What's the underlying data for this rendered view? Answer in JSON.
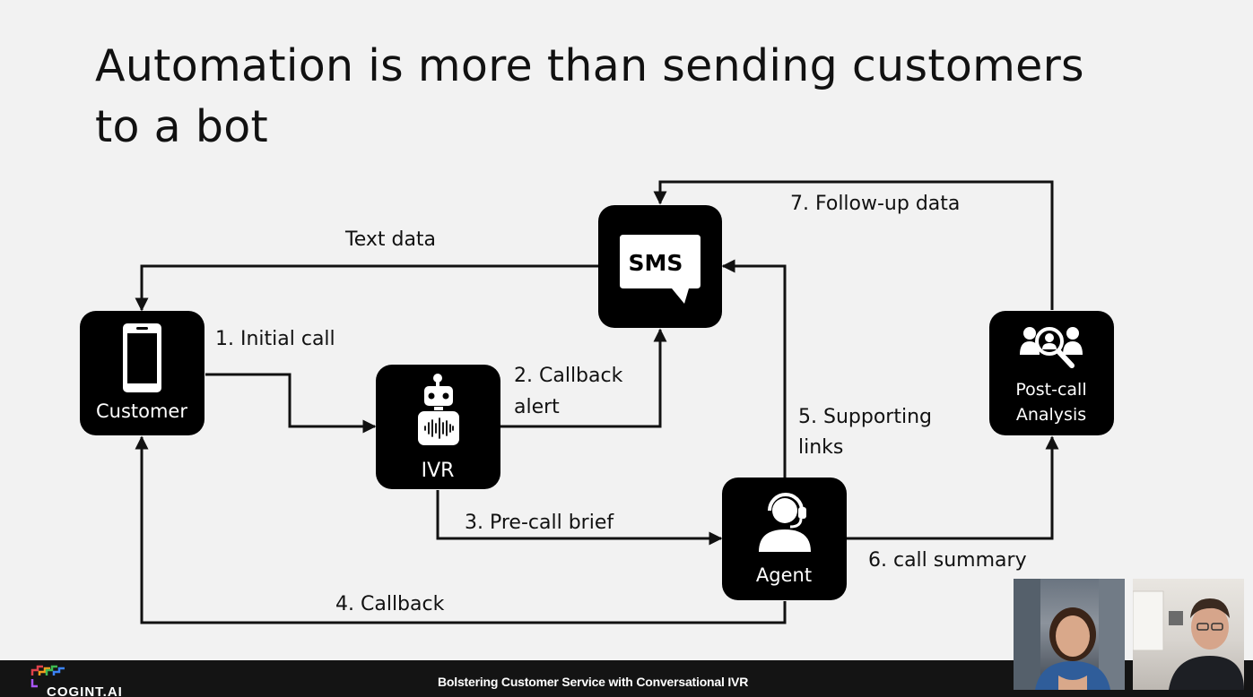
{
  "slide": {
    "title_line1": "Automation is more than sending customers",
    "title_line2": "to a bot"
  },
  "nodes": {
    "sms": {
      "label": "SMS",
      "icon": "sms-bubble-icon"
    },
    "customer": {
      "label": "Customer",
      "icon": "phone-icon"
    },
    "ivr": {
      "label": "IVR",
      "icon": "robot-icon"
    },
    "agent": {
      "label": "Agent",
      "icon": "headset-agent-icon"
    },
    "postcall": {
      "label_line1": "Post-call",
      "label_line2": "Analysis",
      "icon": "people-search-icon"
    }
  },
  "edges": {
    "text_data": "Text data",
    "initial_call": "1. Initial call",
    "callback_alert_line1": "2. Callback",
    "callback_alert_line2": "alert",
    "pre_call_brief": "3. Pre-call brief",
    "callback": "4. Callback",
    "supporting_links_line1": "5. Supporting",
    "supporting_links_line2": "links",
    "call_summary": "6. call summary",
    "follow_up_data": "7. Follow-up data"
  },
  "footer": {
    "presentation_title": "Bolstering Customer Service with Conversational IVR",
    "brand": "COGINT.AI"
  },
  "colors": {
    "node_fill": "#000000",
    "background": "#f2f2f2",
    "footer_bar": "#141414"
  }
}
